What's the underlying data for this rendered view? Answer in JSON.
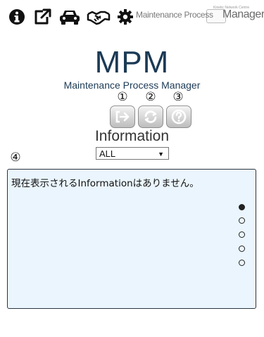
{
  "toolbar": {
    "icons": [
      "info-icon",
      "external-link-icon",
      "car-icon",
      "handshake-icon",
      "gear-icon"
    ],
    "brand": {
      "text_left": "Maintenance Process",
      "text_right": "Manager",
      "tiny_text": "Kinetic Network Centre"
    }
  },
  "header": {
    "title": "MPM",
    "subtitle": "Maintenance Process Manager"
  },
  "actions": [
    {
      "number": "①",
      "icon": "login-arrow-icon"
    },
    {
      "number": "②",
      "icon": "refresh-icon"
    },
    {
      "number": "③",
      "icon": "help-icon"
    }
  ],
  "information": {
    "label": "Information",
    "filter_value": "ALL",
    "panel_number": "④",
    "message": "現在表示されるInformationはありません。",
    "pager": {
      "pages": 5,
      "active_index": 0
    }
  },
  "colors": {
    "title": "#1b3a55",
    "panel_bg": "#eaf5fd",
    "panel_border": "#2b3440"
  }
}
